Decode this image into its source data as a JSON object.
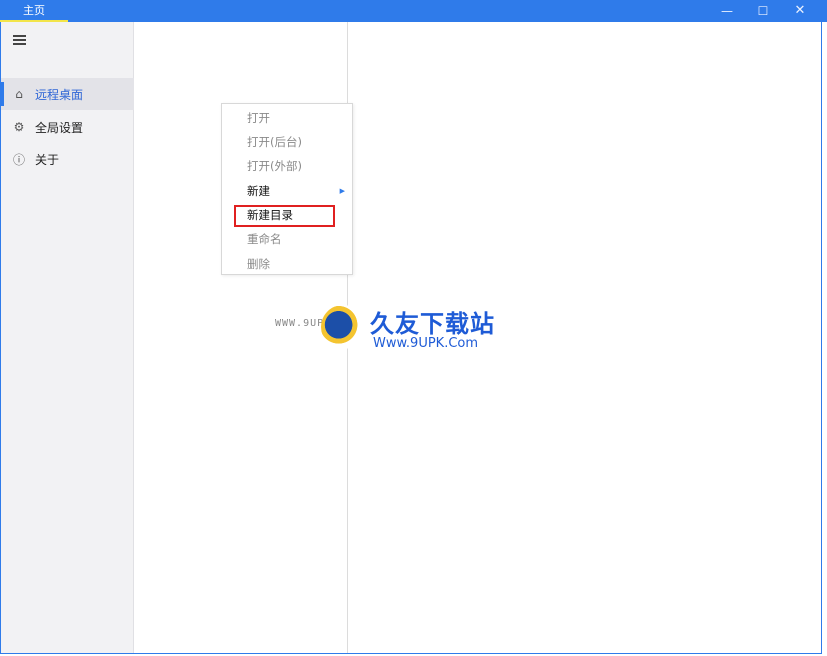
{
  "window": {
    "tab_title": "主页",
    "minimize_symbol": "—",
    "maximize_symbol": "☐",
    "close_symbol": "✕"
  },
  "sidebar": {
    "menu_icon": "hamburger-icon",
    "items": [
      {
        "label": "远程桌面",
        "icon": "home-icon",
        "glyph": "⌂",
        "active": true
      },
      {
        "label": "全局设置",
        "icon": "settings-icon",
        "glyph": "⚙",
        "active": false
      },
      {
        "label": "关于",
        "icon": "info-icon",
        "glyph": "ⓘ",
        "active": false
      }
    ]
  },
  "context_menu": {
    "items": [
      {
        "label": "打开",
        "enabled": false
      },
      {
        "label": "打开(后台)",
        "enabled": false
      },
      {
        "label": "打开(外部)",
        "enabled": false
      },
      {
        "label": "新建",
        "enabled": true,
        "submenu_arrow": "▶"
      },
      {
        "label": "新建目录",
        "enabled": true,
        "highlighted": true
      },
      {
        "label": "重命名",
        "enabled": false
      },
      {
        "label": "删除",
        "enabled": false
      }
    ]
  },
  "watermark": {
    "small_text": "WWW.9UPK.COM",
    "brand": "久友下载站",
    "url": "Www.9UPK.Com"
  },
  "colors": {
    "accent": "#2f7bea",
    "highlight_border": "#e02020",
    "tab_underline": "#f3e54a"
  }
}
